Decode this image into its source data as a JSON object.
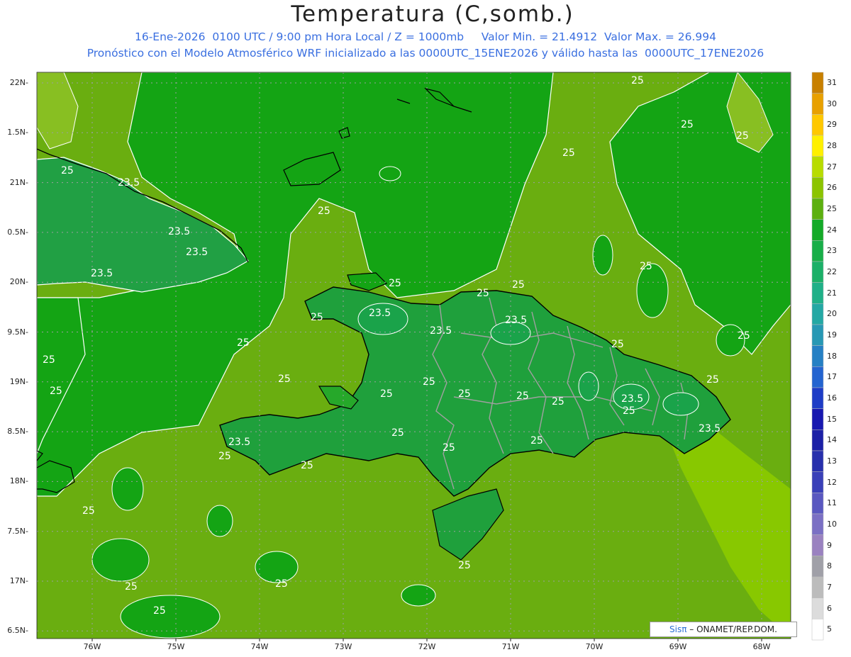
{
  "title": "Temperatura (C,somb.)",
  "subtitle_line1": "16-Ene-2026  0100 UTC / 9:00 pm Hora Local / Z = 1000mb     Valor Min. = 21.4912  Valor Max. = 26.994",
  "subtitle_line2": "Pronóstico con el Modelo Atmosférico WRF inicializado a las 0000UTC_15ENE2026 y válido hasta las  0000UTC_17ENE2026",
  "credit_logo": "Sisπ",
  "credit_text": " – ONAMET/REP.DOM.",
  "lat_labels": [
    "22N",
    "1.5N",
    "21N",
    "0.5N",
    "20N",
    "9.5N",
    "19N",
    "8.5N",
    "18N",
    "7.5N",
    "17N",
    "6.5N"
  ],
  "lon_labels": [
    "76W",
    "75W",
    "74W",
    "73W",
    "72W",
    "71W",
    "70W",
    "69W",
    "68W"
  ],
  "contour_labels": [
    "25",
    "23.5"
  ],
  "colorbar": {
    "levels": [
      "5",
      "6",
      "7",
      "8",
      "9",
      "10",
      "11",
      "12",
      "13",
      "14",
      "15",
      "16",
      "17",
      "18",
      "19",
      "20",
      "21",
      "22",
      "23",
      "24",
      "25",
      "26",
      "27",
      "28",
      "29",
      "30",
      "31"
    ],
    "colors": [
      "#ffffff",
      "#dcdcdc",
      "#bcbcbc",
      "#a0a0a8",
      "#9a82c0",
      "#7b70c4",
      "#5a58c0",
      "#3a40b8",
      "#2830ac",
      "#1c20a6",
      "#1818b0",
      "#1e3cc6",
      "#2464d0",
      "#2680c4",
      "#2898b4",
      "#24a8a4",
      "#20b088",
      "#1cb068",
      "#18ae48",
      "#14aa28",
      "#5cb010",
      "#8cc400",
      "#b8dc00",
      "#fff000",
      "#ffc800",
      "#e8a000",
      "#c88000"
    ]
  },
  "map_colors": {
    "base": "#6aae10",
    "land24": "#26a82a",
    "sea24": "#14a414",
    "cool23": "#1aa34a",
    "warm26": "#8cc800",
    "ocean_light": "#88bf22"
  }
}
